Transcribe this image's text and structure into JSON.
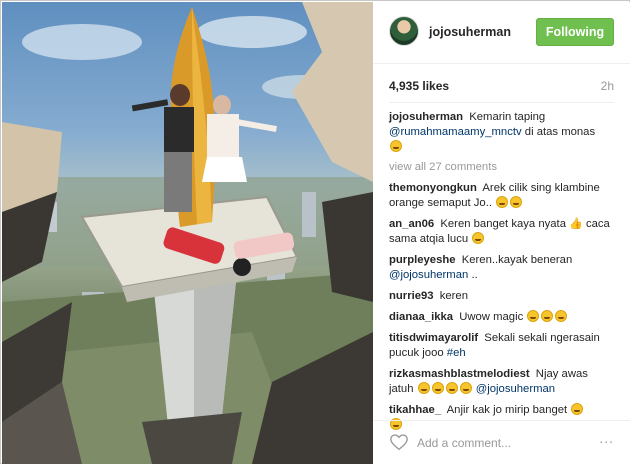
{
  "post": {
    "username": "jojosuherman",
    "follow_label": "Following",
    "likes": "4,935 likes",
    "time": "2h",
    "caption": {
      "user": "jojosuherman",
      "text_a": "Kemarin taping",
      "mention": "@rumahmamaamy_mnctv",
      "text_b": "di atas monas"
    },
    "view_all": "view all 27 comments",
    "comments": [
      {
        "user": "themonyongkun",
        "text": "Arek cilik sing klambine orange semaput Jo..",
        "emojis": 2
      },
      {
        "user": "an_an06",
        "text": "Keren banget kaya nyata",
        "extra": "caca sama atqia lucu",
        "emojis": 1
      },
      {
        "user": "purpleyeshe",
        "text": "Keren..kayak beneran",
        "mention": "@jojosuherman",
        "tail": ".."
      },
      {
        "user": "nurrie93",
        "text": "keren"
      },
      {
        "user": "dianaa_ikka",
        "text": "Uwow magic",
        "emojis": 3
      },
      {
        "user": "titisdwimayarolif",
        "text": "Sekali sekali ngerasain pucuk jooo",
        "hashtag": "#eh"
      },
      {
        "user": "rizkasmashblastmelodiest",
        "text": "Njay awas jatuh",
        "mention": "@jojosuherman",
        "emojis": 4
      },
      {
        "user": "tikahhae_",
        "text": "Anjir kak jo mirip banget",
        "emojis": 2
      }
    ],
    "add_comment_placeholder": "Add a comment...",
    "more_label": "∙∙∙"
  },
  "colors": {
    "follow_bg": "#70c050",
    "mention": "#003569",
    "muted": "#999999"
  },
  "icons": {
    "heart": "heart-icon",
    "more": "more-options-icon",
    "avatar": "avatar"
  }
}
